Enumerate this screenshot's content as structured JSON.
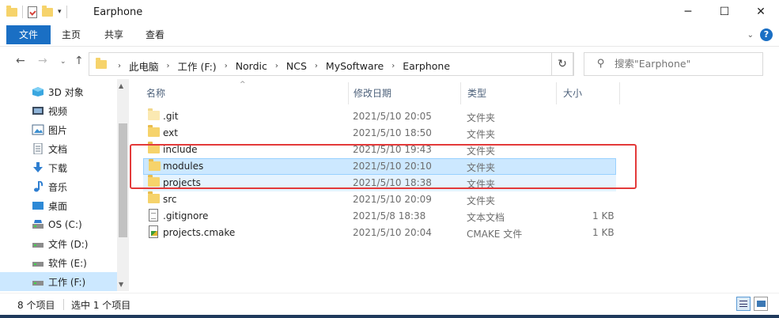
{
  "window": {
    "title": "Earphone",
    "controls": {
      "minimize": "─",
      "maximize": "☐",
      "close": "✕"
    }
  },
  "ribbon": {
    "tabs": [
      "文件",
      "主页",
      "共享",
      "查看"
    ],
    "help": "?"
  },
  "address": {
    "crumbs": [
      "此电脑",
      "工作 (F:)",
      "Nordic",
      "NCS",
      "MySoftware",
      "Earphone"
    ],
    "search_placeholder": "搜索\"Earphone\""
  },
  "nav": {
    "items": [
      {
        "label": "3D 对象",
        "icon": "3d-objects-icon"
      },
      {
        "label": "视频",
        "icon": "video-icon"
      },
      {
        "label": "图片",
        "icon": "pictures-icon"
      },
      {
        "label": "文档",
        "icon": "documents-icon"
      },
      {
        "label": "下载",
        "icon": "download-icon"
      },
      {
        "label": "音乐",
        "icon": "music-icon"
      },
      {
        "label": "桌面",
        "icon": "desktop-icon"
      },
      {
        "label": "OS (C:)",
        "icon": "drive-icon"
      },
      {
        "label": "文件 (D:)",
        "icon": "drive-icon"
      },
      {
        "label": "软件 (E:)",
        "icon": "drive-icon"
      },
      {
        "label": "工作 (F:)",
        "icon": "drive-icon",
        "selected": true
      }
    ]
  },
  "list": {
    "columns": [
      "名称",
      "修改日期",
      "类型",
      "大小"
    ],
    "rows": [
      {
        "name": ".git",
        "date": "2021/5/10 20:05",
        "type": "文件夹",
        "size": "",
        "icon": "folder-hidden-icon"
      },
      {
        "name": "ext",
        "date": "2021/5/10 18:50",
        "type": "文件夹",
        "size": "",
        "icon": "folder-icon"
      },
      {
        "name": "include",
        "date": "2021/5/10 19:43",
        "type": "文件夹",
        "size": "",
        "icon": "folder-icon"
      },
      {
        "name": "modules",
        "date": "2021/5/10 20:10",
        "type": "文件夹",
        "size": "",
        "icon": "folder-icon",
        "selected": true
      },
      {
        "name": "projects",
        "date": "2021/5/10 18:38",
        "type": "文件夹",
        "size": "",
        "icon": "folder-icon"
      },
      {
        "name": "src",
        "date": "2021/5/10 20:09",
        "type": "文件夹",
        "size": "",
        "icon": "folder-icon"
      },
      {
        "name": ".gitignore",
        "date": "2021/5/8 18:38",
        "type": "文本文档",
        "size": "1 KB",
        "icon": "text-file-icon"
      },
      {
        "name": "projects.cmake",
        "date": "2021/5/10 20:04",
        "type": "CMAKE 文件",
        "size": "1 KB",
        "icon": "cmake-file-icon"
      }
    ]
  },
  "status": {
    "count": "8 个项目",
    "selected": "选中 1 个项目"
  },
  "colors": {
    "accent": "#1a6fc4",
    "selection": "#cce8ff",
    "highlight_box": "#e33a3a"
  }
}
